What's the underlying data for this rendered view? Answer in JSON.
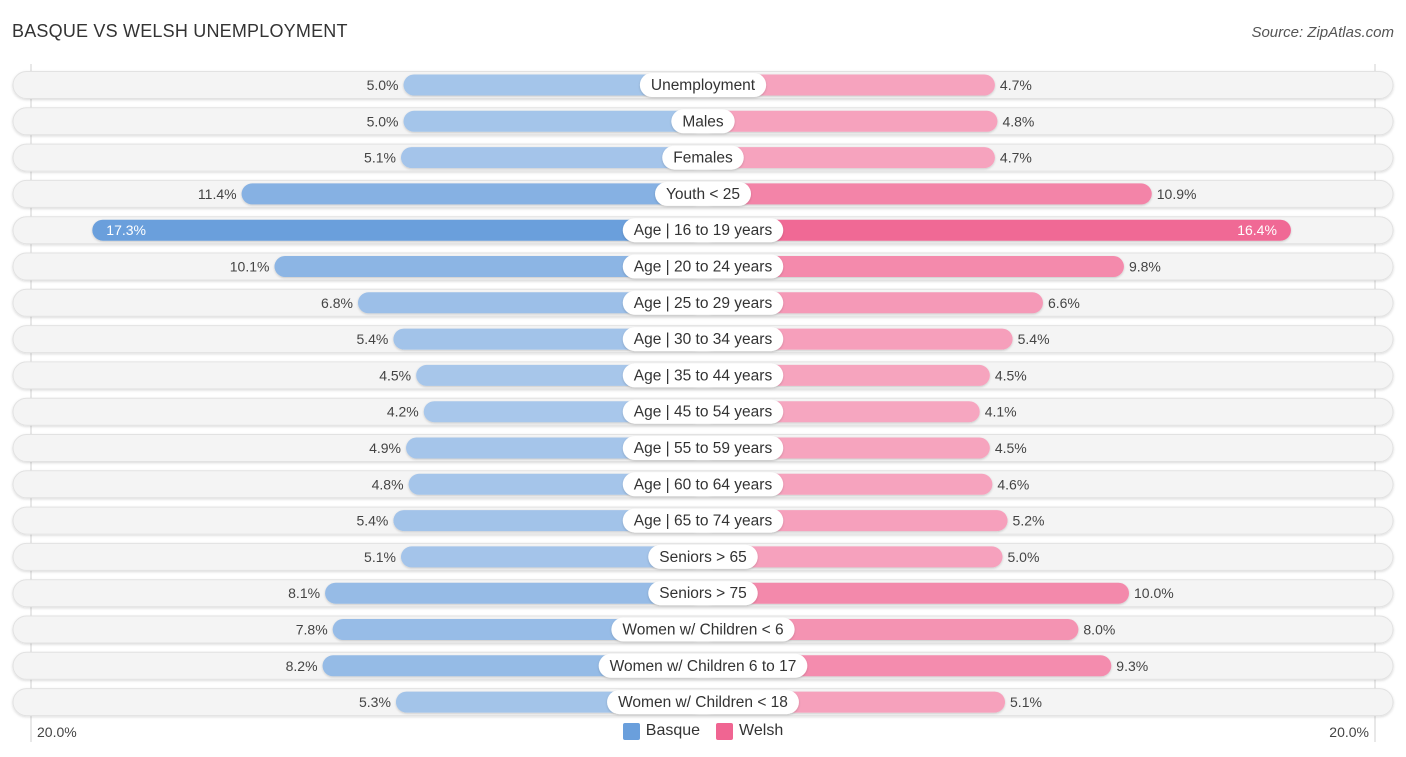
{
  "title": "BASQUE VS WELSH UNEMPLOYMENT",
  "source": "Source: ZipAtlas.com",
  "chart_data": {
    "type": "bar",
    "orientation": "horizontal-diverging",
    "title": "BASQUE VS WELSH UNEMPLOYMENT",
    "categories": [
      "Unemployment",
      "Males",
      "Females",
      "Youth < 25",
      "Age | 16 to 19 years",
      "Age | 20 to 24 years",
      "Age | 25 to 29 years",
      "Age | 30 to 34 years",
      "Age | 35 to 44 years",
      "Age | 45 to 54 years",
      "Age | 55 to 59 years",
      "Age | 60 to 64 years",
      "Age | 65 to 74 years",
      "Seniors > 65",
      "Seniors > 75",
      "Women w/ Children < 6",
      "Women w/ Children 6 to 17",
      "Women w/ Children < 18"
    ],
    "series": [
      {
        "name": "Basque",
        "color": "#6a9fdc",
        "values": [
          5.0,
          5.0,
          5.1,
          11.4,
          17.3,
          10.1,
          6.8,
          5.4,
          4.5,
          4.2,
          4.9,
          4.8,
          5.4,
          5.1,
          8.1,
          7.8,
          8.2,
          5.3
        ]
      },
      {
        "name": "Welsh",
        "color": "#f06592",
        "values": [
          4.7,
          4.8,
          4.7,
          10.9,
          16.4,
          9.8,
          6.6,
          5.4,
          4.5,
          4.1,
          4.5,
          4.6,
          5.2,
          5.0,
          10.0,
          8.0,
          9.3,
          5.1
        ]
      }
    ],
    "value_suffix": "%",
    "axis_max": 20.0,
    "axis_left_label": "20.0%",
    "axis_right_label": "20.0%",
    "legend_position": "bottom-center",
    "grid": false
  },
  "legend": [
    {
      "name": "Basque",
      "color": "#6a9fdc"
    },
    {
      "name": "Welsh",
      "color": "#f06592"
    }
  ],
  "axis": {
    "left": "20.0%",
    "right": "20.0%"
  }
}
